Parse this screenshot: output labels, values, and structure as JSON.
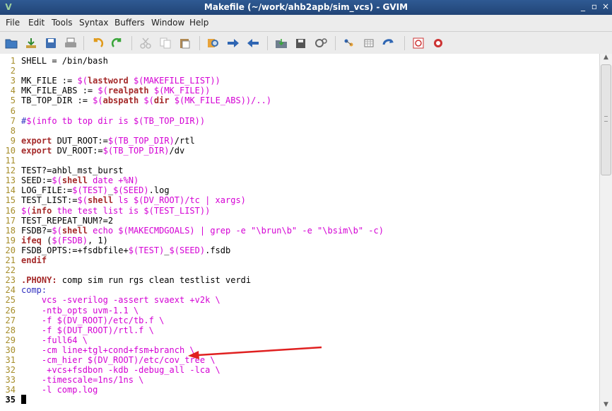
{
  "window": {
    "title": "Makefile (~/work/ahb2apb/sim_vcs) - GVIM",
    "minimize": "_",
    "maximize": "▫",
    "close": "×"
  },
  "menu": [
    "File",
    "Edit",
    "Tools",
    "Syntax",
    "Buffers",
    "Window",
    "Help"
  ],
  "toolbar_icons": [
    "open-file-icon",
    "save-icon",
    "save-all-icon",
    "print-icon",
    "undo-icon",
    "redo-icon",
    "cut-icon",
    "copy-icon",
    "paste-icon",
    "find-replace-icon",
    "find-next-icon",
    "find-prev-icon",
    "load-session-icon",
    "save-session-icon",
    "run-script-icon",
    "make-icon",
    "shell-icon",
    "tag-jump-icon",
    "help-icon",
    "find-help-icon"
  ],
  "colors": {
    "line_number": "#a68d2a",
    "keyword": "#a52a2a",
    "variable": "#d400d4",
    "arrow": "#e02020"
  },
  "lines": [
    {
      "n": "1",
      "segs": [
        [
          "t",
          "SHELL = /bin/bash"
        ]
      ]
    },
    {
      "n": "2",
      "segs": []
    },
    {
      "n": "3",
      "segs": [
        [
          "t",
          "MK_FILE := "
        ],
        [
          "var",
          "$("
        ],
        [
          "kw",
          "lastword"
        ],
        [
          "var",
          " $(MAKEFILE_LIST))"
        ]
      ]
    },
    {
      "n": "4",
      "segs": [
        [
          "t",
          "MK_FILE_ABS := "
        ],
        [
          "var",
          "$("
        ],
        [
          "kw",
          "realpath"
        ],
        [
          "var",
          " $(MK_FILE))"
        ]
      ]
    },
    {
      "n": "5",
      "segs": [
        [
          "t",
          "TB_TOP_DIR := "
        ],
        [
          "var",
          "$("
        ],
        [
          "kw",
          "abspath"
        ],
        [
          "var",
          " $("
        ],
        [
          "kw",
          "dir"
        ],
        [
          "var",
          " $(MK_FILE_ABS))/..)"
        ]
      ]
    },
    {
      "n": "6",
      "segs": []
    },
    {
      "n": "7",
      "segs": [
        [
          "bl",
          "#"
        ],
        [
          "var",
          "$(info tb top dir is $(TB_TOP_DIR))"
        ]
      ]
    },
    {
      "n": "8",
      "segs": []
    },
    {
      "n": "9",
      "segs": [
        [
          "kw",
          "export"
        ],
        [
          "t",
          " DUT_ROOT:="
        ],
        [
          "var",
          "$(TB_TOP_DIR)"
        ],
        [
          "t",
          "/rtl"
        ]
      ]
    },
    {
      "n": "10",
      "segs": [
        [
          "kw",
          "export"
        ],
        [
          "t",
          " DV_ROOT:="
        ],
        [
          "var",
          "$(TB_TOP_DIR)"
        ],
        [
          "t",
          "/dv"
        ]
      ]
    },
    {
      "n": "11",
      "segs": []
    },
    {
      "n": "12",
      "segs": [
        [
          "t",
          "TEST?=ahbl_mst_burst"
        ]
      ]
    },
    {
      "n": "13",
      "segs": [
        [
          "t",
          "SEED:="
        ],
        [
          "var",
          "$("
        ],
        [
          "kw",
          "shell"
        ],
        [
          "var",
          " date +%N)"
        ]
      ]
    },
    {
      "n": "14",
      "segs": [
        [
          "t",
          "LOG_FILE:="
        ],
        [
          "var",
          "$(TEST)"
        ],
        [
          "t",
          "_"
        ],
        [
          "var",
          "$(SEED)"
        ],
        [
          "t",
          ".log"
        ]
      ]
    },
    {
      "n": "15",
      "segs": [
        [
          "t",
          "TEST_LIST:="
        ],
        [
          "var",
          "$("
        ],
        [
          "kw",
          "shell"
        ],
        [
          "var",
          " ls $(DV_ROOT)/tc | xargs)"
        ]
      ]
    },
    {
      "n": "16",
      "segs": [
        [
          "var",
          "$("
        ],
        [
          "kw",
          "info"
        ],
        [
          "var",
          " the test list is $(TEST_LIST))"
        ]
      ]
    },
    {
      "n": "17",
      "segs": [
        [
          "t",
          "TEST_REPEAT_NUM?=2"
        ]
      ]
    },
    {
      "n": "18",
      "segs": [
        [
          "t",
          "FSDB?="
        ],
        [
          "var",
          "$("
        ],
        [
          "kw",
          "shell"
        ],
        [
          "var",
          " echo $(MAKECMDGOALS) | grep -e \"\\brun\\b\" -e \"\\bsim\\b\" -c)"
        ]
      ]
    },
    {
      "n": "19",
      "segs": [
        [
          "kw",
          "ifeq"
        ],
        [
          "t",
          " ("
        ],
        [
          "var",
          "$(FSDB)"
        ],
        [
          "t",
          ", 1)"
        ]
      ]
    },
    {
      "n": "20",
      "segs": [
        [
          "t",
          "FSDB_OPTS:=+fsdbfile+"
        ],
        [
          "var",
          "$(TEST)"
        ],
        [
          "t",
          "_"
        ],
        [
          "var",
          "$(SEED)"
        ],
        [
          "t",
          ".fsdb"
        ]
      ]
    },
    {
      "n": "21",
      "segs": [
        [
          "kw",
          "endif"
        ]
      ]
    },
    {
      "n": "22",
      "segs": []
    },
    {
      "n": "23",
      "segs": [
        [
          "kw",
          ".PHONY:"
        ],
        [
          "t",
          " comp sim run rgs clean testlist verdi"
        ]
      ]
    },
    {
      "n": "24",
      "segs": [
        [
          "bl",
          "comp:"
        ]
      ]
    },
    {
      "n": "25",
      "segs": [
        [
          "mg",
          "    vcs -sverilog -assert svaext +v2k \\"
        ]
      ]
    },
    {
      "n": "26",
      "segs": [
        [
          "mg",
          "    -ntb_opts uvm-1.1 \\"
        ]
      ]
    },
    {
      "n": "27",
      "segs": [
        [
          "mg",
          "    -f "
        ],
        [
          "var",
          "$(DV_ROOT)"
        ],
        [
          "mg",
          "/etc/tb.f \\"
        ]
      ]
    },
    {
      "n": "28",
      "segs": [
        [
          "mg",
          "    -f "
        ],
        [
          "var",
          "$(DUT_ROOT)"
        ],
        [
          "mg",
          "/rtl.f \\"
        ]
      ]
    },
    {
      "n": "29",
      "segs": [
        [
          "mg",
          "    -full64 \\"
        ]
      ]
    },
    {
      "n": "30",
      "segs": [
        [
          "mg",
          "    -cm line+tgl+cond+fsm+branch \\"
        ]
      ]
    },
    {
      "n": "31",
      "segs": [
        [
          "mg",
          "    -cm_hier "
        ],
        [
          "var",
          "$(DV_ROOT)"
        ],
        [
          "mg",
          "/etc/cov_tree \\"
        ]
      ]
    },
    {
      "n": "32",
      "segs": [
        [
          "mg",
          "     +vcs+fsdbon -kdb -debug_all -lca \\"
        ]
      ]
    },
    {
      "n": "33",
      "segs": [
        [
          "mg",
          "    -timescale=1ns/1ns \\"
        ]
      ]
    },
    {
      "n": "34",
      "segs": [
        [
          "mg",
          "    -l comp.log"
        ]
      ]
    },
    {
      "n": "35",
      "segs": [],
      "cursor": true
    }
  ]
}
